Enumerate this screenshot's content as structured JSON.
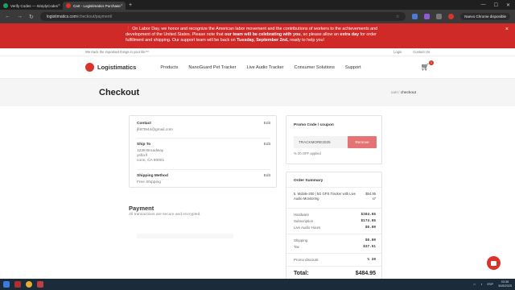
{
  "browser": {
    "tabs": [
      {
        "title": "Verify Codes — SimplyCodes",
        "color": "#1aa260",
        "active": false
      },
      {
        "title": "Cart - Logistimatics Purchase",
        "color": "#d9342b",
        "active": true
      }
    ],
    "url_domain": "logistimatics.com",
    "url_path": "/checkout/payment/",
    "profile_label": "Nuevo Chrome disponible"
  },
  "banner": {
    "text_1": "On Labor Day, we honor and recognize the American labor movement and the contributions of workers to the achievements and development of the United States. Please note that ",
    "bold_1": "our team will be celebrating with you",
    "text_2": ", so please allow an ",
    "bold_2": "extra day",
    "text_3": " for order fulfillment and shipping. Our support team will be back on ",
    "bold_3": "Tuesday, September 2nd,",
    "text_4": " ready to help you!",
    "close": "×"
  },
  "topstrip": {
    "tagline": "We track the important things in your life™",
    "login": "Login",
    "contact": "Contact Us"
  },
  "header": {
    "brand": "Logistimatics",
    "nav": [
      "Products",
      "NanoGuard Pet Tracker",
      "Live Audio Tracker",
      "Consumer Solutions",
      "Support"
    ],
    "cart_count": "1"
  },
  "page": {
    "title": "Checkout",
    "crumb_parent": "cart",
    "crumb_sep": " / ",
    "crumb_current": "checkout"
  },
  "info": {
    "contact_label": "Contact",
    "contact_value": "jfi97t944@gmail.com",
    "shipto_label": "Ship To",
    "shipto_line1": "1238 Broadway",
    "shipto_line2": "yella ll",
    "shipto_line3": "conn, CA 90001",
    "method_label": "Shipping Method",
    "method_value": "Free Shipping",
    "edit": "Edit"
  },
  "payment": {
    "title": "Payment",
    "subtitle": "All transactions are secure and encrypted."
  },
  "promo": {
    "title": "Promo Code / coupon",
    "code": "TRACKMORE2025",
    "remove": "Remove",
    "applied": "% 20 OFF applied"
  },
  "order": {
    "title": "Order Summary",
    "item_name": "5. Mobile-200 | 5G GPS Tracker with Live Audio Monitoring",
    "item_price": "$54.95",
    "item_qty": "x7",
    "lines": [
      {
        "label": "Hardware",
        "value": "$384.65"
      },
      {
        "label": "Subscription",
        "value": "$174.65"
      },
      {
        "label": "Live Audio Hours",
        "value": "$0.00"
      },
      {
        "label": "Shipping",
        "value": "$0.00"
      },
      {
        "label": "Tax",
        "value": "$37.51"
      },
      {
        "label": "Promo discount",
        "value": "% 20"
      }
    ],
    "total_label": "Total:",
    "total_value": "$484.95"
  },
  "taskbar": {
    "time": "03:38",
    "date": "30/8/2025",
    "lang": "ESP"
  }
}
